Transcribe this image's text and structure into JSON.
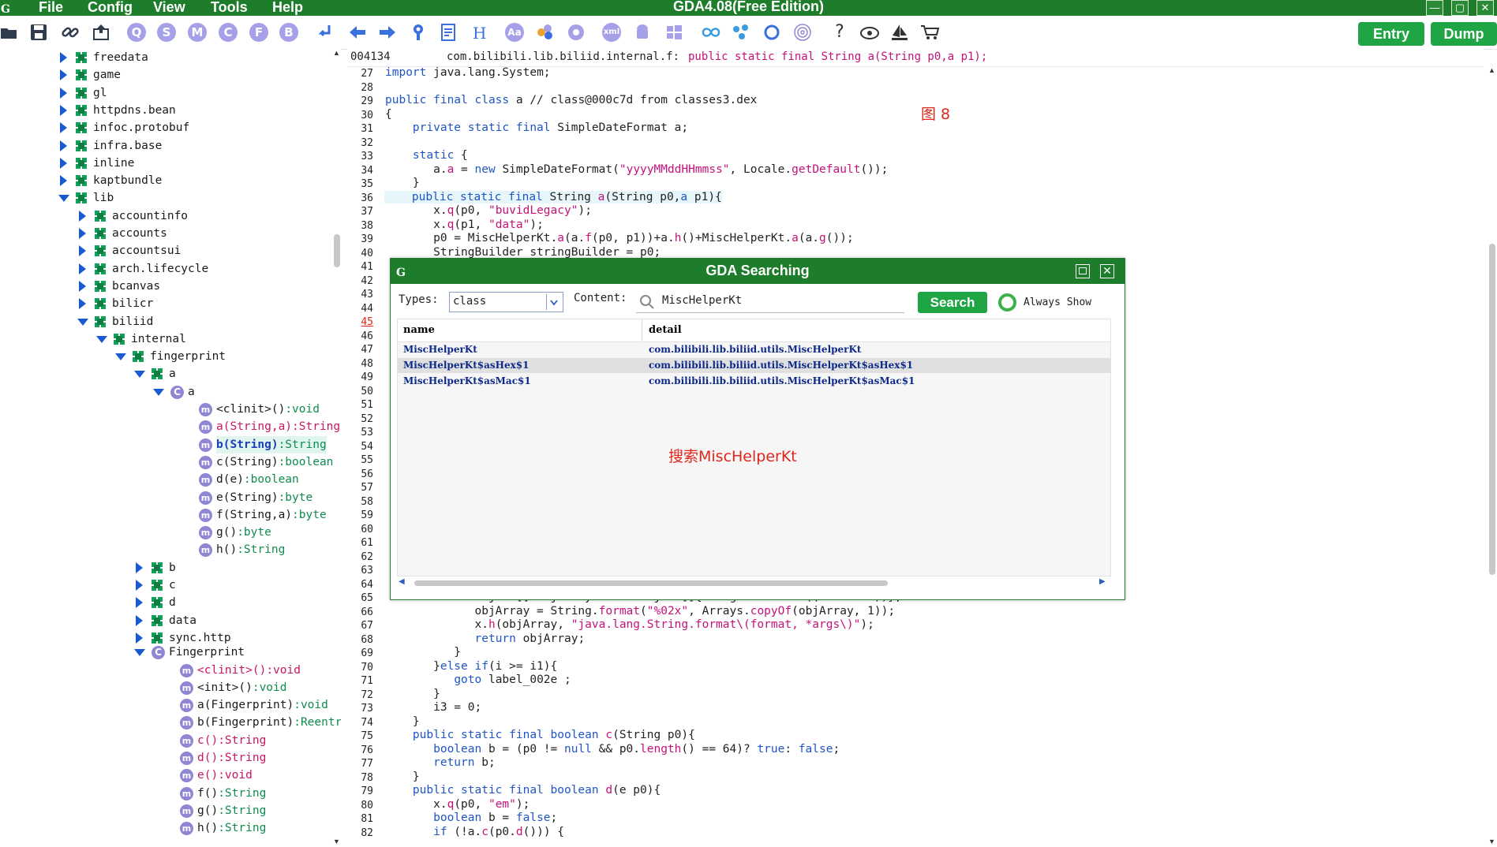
{
  "app": {
    "title": "GDA4.08(Free Edition)",
    "menu": [
      "File",
      "Config",
      "View",
      "Tools",
      "Help"
    ]
  },
  "toolbar": {
    "circle_letters": [
      "Q",
      "S",
      "M",
      "C",
      "F",
      "B"
    ],
    "xml_label": "xml",
    "aa_label": "Aa",
    "help_label": "?",
    "entry_label": "Entry",
    "dump_label": "Dump"
  },
  "header": {
    "offset": "004134",
    "class_path": "com.bilibili.lib.biliid.internal.f:",
    "signature": "public static final String a(String p0,a p1);"
  },
  "tree": {
    "nodes": [
      {
        "label": "freedata",
        "level": 1,
        "kind": "pkg",
        "state": "collapsed"
      },
      {
        "label": "game",
        "level": 1,
        "kind": "pkg",
        "state": "collapsed"
      },
      {
        "label": "gl",
        "level": 1,
        "kind": "pkg",
        "state": "collapsed"
      },
      {
        "label": "httpdns.bean",
        "level": 1,
        "kind": "pkg",
        "state": "collapsed"
      },
      {
        "label": "infoc.protobuf",
        "level": 1,
        "kind": "pkg",
        "state": "collapsed"
      },
      {
        "label": "infra.base",
        "level": 1,
        "kind": "pkg",
        "state": "collapsed"
      },
      {
        "label": "inline",
        "level": 1,
        "kind": "pkg",
        "state": "collapsed"
      },
      {
        "label": "kaptbundle",
        "level": 1,
        "kind": "pkg",
        "state": "collapsed"
      },
      {
        "label": "lib",
        "level": 1,
        "kind": "pkg",
        "state": "expanded"
      },
      {
        "label": "accountinfo",
        "level": 2,
        "kind": "pkg",
        "state": "collapsed"
      },
      {
        "label": "accounts",
        "level": 2,
        "kind": "pkg",
        "state": "collapsed"
      },
      {
        "label": "accountsui",
        "level": 2,
        "kind": "pkg",
        "state": "collapsed"
      },
      {
        "label": "arch.lifecycle",
        "level": 2,
        "kind": "pkg",
        "state": "collapsed"
      },
      {
        "label": "bcanvas",
        "level": 2,
        "kind": "pkg",
        "state": "collapsed"
      },
      {
        "label": "bilicr",
        "level": 2,
        "kind": "pkg",
        "state": "collapsed"
      },
      {
        "label": "biliid",
        "level": 2,
        "kind": "pkg",
        "state": "expanded"
      },
      {
        "label": "internal",
        "level": 3,
        "kind": "pkg",
        "state": "expanded"
      },
      {
        "label": "fingerprint",
        "level": 4,
        "kind": "pkg",
        "state": "expanded"
      },
      {
        "label": "a",
        "level": 5,
        "kind": "pkg",
        "state": "expanded"
      },
      {
        "label": "a",
        "level": 6,
        "kind": "class",
        "state": "expanded"
      },
      {
        "label": "<clinit>()",
        "ret": ":void",
        "level": 7,
        "kind": "method"
      },
      {
        "label": "a(String,a)",
        "ret": ":String",
        "level": 7,
        "kind": "method",
        "style": "red"
      },
      {
        "label": "b(String)",
        "ret": ":String",
        "level": 7,
        "kind": "method",
        "style": "selected"
      },
      {
        "label": "c(String)",
        "ret": ":boolean",
        "level": 7,
        "kind": "method"
      },
      {
        "label": "d(e)",
        "ret": ":boolean",
        "level": 7,
        "kind": "method"
      },
      {
        "label": "e(String)",
        "ret": ":byte",
        "level": 7,
        "kind": "method"
      },
      {
        "label": "f(String,a)",
        "ret": ":byte",
        "level": 7,
        "kind": "method"
      },
      {
        "label": "g()",
        "ret": ":byte",
        "level": 7,
        "kind": "method"
      },
      {
        "label": "h()",
        "ret": ":String",
        "level": 7,
        "kind": "method"
      },
      {
        "label": "b",
        "level": 5,
        "kind": "pkg",
        "state": "collapsed"
      },
      {
        "label": "c",
        "level": 5,
        "kind": "pkg",
        "state": "collapsed"
      },
      {
        "label": "d",
        "level": 5,
        "kind": "pkg",
        "state": "collapsed"
      },
      {
        "label": "data",
        "level": 5,
        "kind": "pkg",
        "state": "collapsed"
      },
      {
        "label": "sync.http",
        "level": 5,
        "kind": "pkg",
        "state": "collapsed"
      },
      {
        "label": "Fingerprint",
        "level": 5,
        "kind": "class",
        "state": "expanded"
      },
      {
        "label": "<clinit>()",
        "ret": ":void",
        "level": 6,
        "kind": "method",
        "style": "red"
      },
      {
        "label": "<init>()",
        "ret": ":void",
        "level": 6,
        "kind": "method"
      },
      {
        "label": "a(Fingerprint)",
        "ret": ":void",
        "level": 6,
        "kind": "method"
      },
      {
        "label": "b(Fingerprint)",
        "ret": ":Reentr",
        "level": 6,
        "kind": "method"
      },
      {
        "label": "c()",
        "ret": ":String",
        "level": 6,
        "kind": "method",
        "style": "red"
      },
      {
        "label": "d()",
        "ret": ":String",
        "level": 6,
        "kind": "method",
        "style": "red"
      },
      {
        "label": "e()",
        "ret": ":void",
        "level": 6,
        "kind": "method",
        "style": "red"
      },
      {
        "label": "f()",
        "ret": ":String",
        "level": 6,
        "kind": "method"
      },
      {
        "label": "g()",
        "ret": ":String",
        "level": 6,
        "kind": "method"
      },
      {
        "label": "h()",
        "ret": ":String",
        "level": 6,
        "kind": "method"
      }
    ]
  },
  "code": {
    "annotation_top": "图 8",
    "lines": [
      {
        "n": "27",
        "html": "<span class='kw'>import</span> java.lang.System;"
      },
      {
        "n": "28",
        "html": ""
      },
      {
        "n": "29",
        "html": "<span class='kw'>public final class</span> a // class@000c7d from classes3.dex"
      },
      {
        "n": "30",
        "html": "{"
      },
      {
        "n": "31",
        "html": "    <span class='kw'>private static final</span> SimpleDateFormat a;"
      },
      {
        "n": "32",
        "html": ""
      },
      {
        "n": "33",
        "html": "    <span class='kw'>static</span> {"
      },
      {
        "n": "34",
        "html": "       a.<span class='fn'>a</span> = <span class='kw'>new</span> SimpleDateFormat(<span class='str'>\"yyyyMMddHHmmss\"</span>, Locale.<span class='fn'>getDefault</span>());"
      },
      {
        "n": "35",
        "html": "    }"
      },
      {
        "n": "36",
        "html": "    <span class='kw'>public static final</span> String <span class='fn'>a</span>(String p0,<span class='kw'>a</span> p1){",
        "hl": true
      },
      {
        "n": "37",
        "html": "       x.<span class='fn'>q</span>(p0, <span class='str'>\"buvidLegacy\"</span>);"
      },
      {
        "n": "38",
        "html": "       x.<span class='fn'>q</span>(p1, <span class='str'>\"data\"</span>);"
      },
      {
        "n": "39",
        "html": "       p0 = MiscHelperKt.<span class='fn'>a</span>(a.<span class='fn'>f</span>(p0, p1))+a.<span class='fn'>h</span>()+MiscHelperKt.<span class='fn'>a</span>(a.<span class='fn'>g</span>());"
      },
      {
        "n": "40",
        "html": "       StringBuilder stringBuilder = p0;"
      },
      {
        "n": "41",
        "html": ""
      },
      {
        "n": "42",
        "html": ""
      },
      {
        "n": "43",
        "html": ""
      },
      {
        "n": "44",
        "html": ""
      },
      {
        "n": "45",
        "html": "",
        "red": true
      },
      {
        "n": "46",
        "html": ""
      },
      {
        "n": "47",
        "html": ""
      },
      {
        "n": "48",
        "html": ""
      },
      {
        "n": "49",
        "html": ""
      },
      {
        "n": "50",
        "html": ""
      },
      {
        "n": "51",
        "html": ""
      },
      {
        "n": "52",
        "html": ""
      },
      {
        "n": "53",
        "html": ""
      },
      {
        "n": "54",
        "html": ""
      },
      {
        "n": "55",
        "html": ""
      },
      {
        "n": "56",
        "html": ""
      },
      {
        "n": "57",
        "html": ""
      },
      {
        "n": "58",
        "html": ""
      },
      {
        "n": "59",
        "html": ""
      },
      {
        "n": "60",
        "html": ""
      },
      {
        "n": "61",
        "html": ""
      },
      {
        "n": "62",
        "html": ""
      },
      {
        "n": "63",
        "html": ""
      },
      {
        "n": "64",
        "html": ""
      },
      {
        "n": "65",
        "html": "             Object[] objArray = <span class='kw'>new</span> Object[]{Integer.<span class='fn'>valueOf</span>((i3 % 256))};"
      },
      {
        "n": "66",
        "html": "             objArray = String.<span class='fn'>format</span>(<span class='str'>\"%02x\"</span>, Arrays.<span class='fn'>copyOf</span>(objArray, 1));"
      },
      {
        "n": "67",
        "html": "             x.<span class='fn'>h</span>(objArray, <span class='str'>\"java.lang.String.format\\(format, *args\\)\"</span>);"
      },
      {
        "n": "68",
        "html": "             <span class='kw'>return</span> objArray;"
      },
      {
        "n": "69",
        "html": "          }"
      },
      {
        "n": "70",
        "html": "       }<span class='kw'>else if</span>(i >= i1){"
      },
      {
        "n": "71",
        "html": "          <span class='kw'>goto</span> label_002e ;"
      },
      {
        "n": "72",
        "html": "       }"
      },
      {
        "n": "73",
        "html": "       i3 = 0;"
      },
      {
        "n": "74",
        "html": "    }"
      },
      {
        "n": "75",
        "html": "    <span class='kw'>public static final boolean</span> <span class='fn'>c</span>(String p0){"
      },
      {
        "n": "76",
        "html": "       <span class='kw'>boolean</span> b = (p0 != <span class='kw'>null</span> && p0.<span class='fn'>length</span>() == 64)? <span class='kw'>true</span>: <span class='kw'>false</span>;"
      },
      {
        "n": "77",
        "html": "       <span class='kw'>return</span> b;"
      },
      {
        "n": "78",
        "html": "    }"
      },
      {
        "n": "79",
        "html": "    <span class='kw'>public static final boolean</span> <span class='fn'>d</span>(e p0){"
      },
      {
        "n": "80",
        "html": "       x.<span class='fn'>q</span>(p0, <span class='str'>\"em\"</span>);"
      },
      {
        "n": "81",
        "html": "       <span class='kw'>boolean</span> b = <span class='kw'>false</span>;"
      },
      {
        "n": "82",
        "html": "       <span class='kw'>if</span> (!a.<span class='fn'>c</span>(p0.<span class='fn'>d</span>())) {"
      }
    ]
  },
  "dialog": {
    "title": "GDA Searching",
    "types_label": "Types:",
    "types_value": "class",
    "content_label": "Content:",
    "content_value": "MiscHelperKt",
    "search_label": "Search",
    "always_show_label": "Always Show",
    "columns": [
      "name",
      "detail"
    ],
    "rows": [
      {
        "name": "MiscHelperKt",
        "detail": "com.bilibili.lib.biliid.utils.MiscHelperKt"
      },
      {
        "name": "MiscHelperKt$asHex$1",
        "detail": "com.bilibili.lib.biliid.utils.MiscHelperKt$asHex$1",
        "selected": true
      },
      {
        "name": "MiscHelperKt$asMac$1",
        "detail": "com.bilibili.lib.biliid.utils.MiscHelperKt$asMac$1"
      }
    ],
    "annotation": "搜索MiscHelperKt"
  },
  "colors": {
    "brand_green": "#1d7d2a",
    "button_green": "#20a544",
    "annotation_red": "#e0261b"
  }
}
